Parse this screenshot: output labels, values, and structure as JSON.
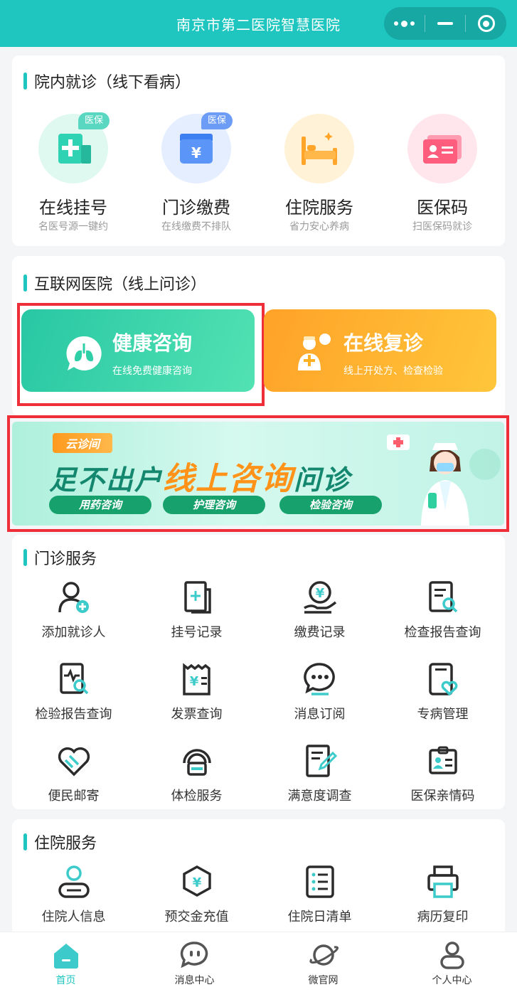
{
  "header": {
    "title": "南京市第二医院智慧医院"
  },
  "offline": {
    "title": "院内就诊（线下看病）",
    "items": [
      {
        "label": "在线挂号",
        "sub": "名医号源一键约",
        "badge": "医保",
        "icon": "register-card-icon",
        "color": "#2fd3b3"
      },
      {
        "label": "门诊缴费",
        "sub": "在线缴费不排队",
        "badge": "医保",
        "icon": "payment-wallet-icon",
        "color": "#4c8bf5"
      },
      {
        "label": "住院服务",
        "sub": "省力安心养病",
        "icon": "hospital-bed-icon",
        "color": "#ffa52a"
      },
      {
        "label": "医保码",
        "sub": "扫医保码就诊",
        "icon": "insurance-card-icon",
        "color": "#ff5d7d"
      }
    ]
  },
  "online": {
    "title": "互联网医院（线上问诊）",
    "consult": {
      "title": "健康咨询",
      "sub": "在线免费健康咨询",
      "icon": "lungs-chat-icon"
    },
    "revisit": {
      "title": "在线复诊",
      "sub": "线上开处方、检查检验",
      "icon": "doctor-icon"
    }
  },
  "banner": {
    "tag": "云诊间",
    "main_a": "足不出户",
    "main_b": "线上咨询",
    "main_c": "问诊",
    "pills": [
      "用药咨询",
      "护理咨询",
      "检验咨询"
    ]
  },
  "outpatient": {
    "title": "门诊服务",
    "items": [
      {
        "label": "添加就诊人",
        "icon": "add-person-icon"
      },
      {
        "label": "挂号记录",
        "icon": "register-record-icon"
      },
      {
        "label": "缴费记录",
        "icon": "payment-record-icon"
      },
      {
        "label": "检查报告查询",
        "icon": "exam-report-icon"
      },
      {
        "label": "检验报告查询",
        "icon": "lab-report-icon"
      },
      {
        "label": "发票查询",
        "icon": "invoice-icon"
      },
      {
        "label": "消息订阅",
        "icon": "message-subscribe-icon"
      },
      {
        "label": "专病管理",
        "icon": "disease-management-icon"
      },
      {
        "label": "便民邮寄",
        "icon": "mail-heart-icon"
      },
      {
        "label": "体检服务",
        "icon": "checkup-icon"
      },
      {
        "label": "满意度调查",
        "icon": "survey-icon"
      },
      {
        "label": "医保亲情码",
        "icon": "family-insurance-icon"
      }
    ]
  },
  "inpatient": {
    "title": "住院服务",
    "items": [
      {
        "label": "住院人信息",
        "icon": "inpatient-info-icon"
      },
      {
        "label": "预交金充值",
        "icon": "deposit-recharge-icon"
      },
      {
        "label": "住院日清单",
        "icon": "daily-list-icon"
      },
      {
        "label": "病历复印",
        "icon": "printer-icon"
      }
    ]
  },
  "tabbar": [
    {
      "label": "首页",
      "icon": "home-icon",
      "active": true
    },
    {
      "label": "消息中心",
      "icon": "message-icon"
    },
    {
      "label": "微官网",
      "icon": "planet-icon"
    },
    {
      "label": "个人中心",
      "icon": "person-icon"
    }
  ],
  "colors": {
    "accent": "#1fc6c0",
    "highlight": "#ee2f3a",
    "orange": "#ffb126"
  }
}
